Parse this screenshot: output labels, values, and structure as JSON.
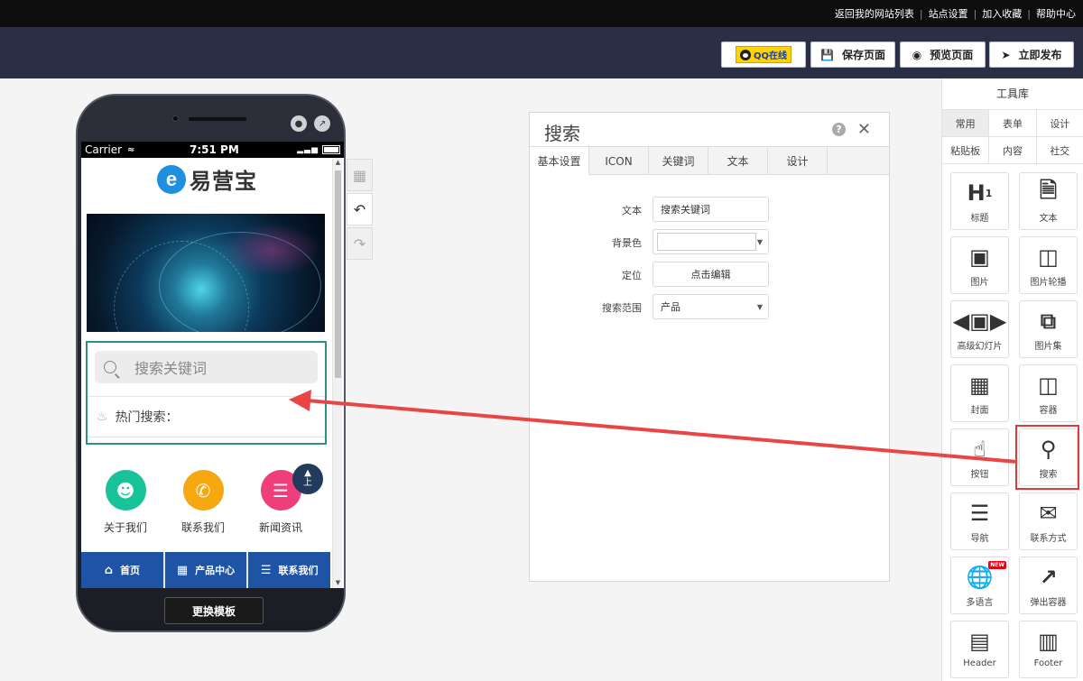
{
  "topbar": {
    "links": [
      "返回我的网站列表",
      "站点设置",
      "加入收藏",
      "帮助中心"
    ]
  },
  "toolbar": {
    "qq_label": "QQ在线",
    "save_label": "保存页面",
    "preview_label": "预览页面",
    "publish_label": "立即发布"
  },
  "phone": {
    "carrier": "Carrier",
    "time": "7:51 PM",
    "logo_letter": "e",
    "logo_text": "易营宝",
    "search_placeholder": "搜索关键词",
    "hot_search": "热门搜索：",
    "back_top": "上",
    "quick_links": [
      {
        "label": "关于我们",
        "color": "#19c39a",
        "icon": "people-icon"
      },
      {
        "label": "联系我们",
        "color": "#f5a80f",
        "icon": "phone-icon"
      },
      {
        "label": "新闻资讯",
        "color": "#ef3f7a",
        "icon": "news-icon"
      }
    ],
    "nav": [
      {
        "label": "首页",
        "icon": "home-icon"
      },
      {
        "label": "产品中心",
        "icon": "product-icon"
      },
      {
        "label": "联系我们",
        "icon": "list-icon"
      }
    ],
    "change_template": "更换模板"
  },
  "panel": {
    "title": "搜索",
    "tabs": [
      "基本设置",
      "ICON",
      "关键词",
      "文本",
      "设计"
    ],
    "active_tab": 0,
    "fields": {
      "text_label": "文本",
      "text_value": "搜索关键词",
      "bg_label": "背景色",
      "position_label": "定位",
      "position_button": "点击编辑",
      "scope_label": "搜索范围",
      "scope_value": "产品"
    }
  },
  "library": {
    "title": "工具库",
    "categories_row1": [
      "常用",
      "表单",
      "设计"
    ],
    "categories_row2": [
      "粘贴板",
      "内容",
      "社交"
    ],
    "active_category": "常用",
    "tiles": [
      {
        "label": "标题",
        "icon": "heading-icon"
      },
      {
        "label": "文本",
        "icon": "text-doc-icon"
      },
      {
        "label": "图片",
        "icon": "image-icon"
      },
      {
        "label": "图片轮播",
        "icon": "image-carousel-icon"
      },
      {
        "label": "高级幻灯片",
        "icon": "slideshow-icon"
      },
      {
        "label": "图片集",
        "icon": "gallery-icon"
      },
      {
        "label": "封面",
        "icon": "cover-icon"
      },
      {
        "label": "容器",
        "icon": "container-icon"
      },
      {
        "label": "按钮",
        "icon": "button-tap-icon"
      },
      {
        "label": "搜索",
        "icon": "search-widget-icon"
      },
      {
        "label": "导航",
        "icon": "nav-list-icon"
      },
      {
        "label": "联系方式",
        "icon": "contact-card-icon"
      },
      {
        "label": "多语言",
        "icon": "globe-icon",
        "badge": "NEW"
      },
      {
        "label": "弹出容器",
        "icon": "popup-icon"
      },
      {
        "label": "Header",
        "icon": "header-layout-icon"
      },
      {
        "label": "Footer",
        "icon": "footer-layout-icon"
      }
    ]
  },
  "colors": {
    "toolbar_bg": "#2a2f45",
    "accent_teal": "#2f8f8a",
    "nav_blue": "#1f53a6",
    "highlight_red": "#e03a3a"
  }
}
